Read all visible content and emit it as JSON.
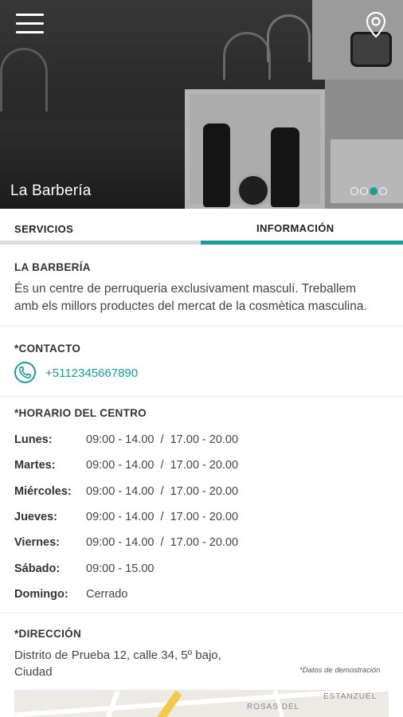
{
  "hero": {
    "title": "La Barbería",
    "slides": {
      "count": 4,
      "active_index": 2
    },
    "accent_color": "#1a9c9c",
    "icons": {
      "menu": "hamburger-menu-icon",
      "location": "map-pin-icon"
    }
  },
  "tabs": [
    {
      "label": "SERVICIOS",
      "active": false
    },
    {
      "label": "INFORMACIÓN",
      "active": true
    }
  ],
  "about": {
    "title": "LA BARBERÍA",
    "description_line1": "És un centre de perruqueria exclusivament masculí. Treballem",
    "description_line2": "amb els millors productes del mercat de la cosmètica masculina."
  },
  "contact": {
    "title": "*CONTACTO",
    "phone": "+5112345667890",
    "icon": "phone-icon"
  },
  "schedule": {
    "title": "*HORARIO DEL CENTRO",
    "days": [
      {
        "day": "Lunes:",
        "hours": "09:00 - 14.00  /  17.00 - 20.00"
      },
      {
        "day": "Martes:",
        "hours": "09:00 - 14.00  /  17.00 - 20.00"
      },
      {
        "day": "Miércoles:",
        "hours": "09:00 - 14.00  /  17.00 - 20.00"
      },
      {
        "day": "Jueves:",
        "hours": "09:00 - 14.00  /  17.00 - 20.00"
      },
      {
        "day": "Viernes:",
        "hours": "09:00 - 14.00  /  17.00 - 20.00"
      },
      {
        "day": "Sábado:",
        "hours": "09:00 - 15.00"
      },
      {
        "day": "Domingo:",
        "hours": "Cerrado"
      }
    ]
  },
  "address": {
    "title": "*DIRECCIÓN",
    "line1": "Distrito de Prueba 12, calle 34, 5º bajo,",
    "line2": "Ciudad",
    "demo_note": "*Datos de demostración"
  },
  "map": {
    "label1": "ROSAS DEL",
    "label2": "ESTANZUEL"
  }
}
